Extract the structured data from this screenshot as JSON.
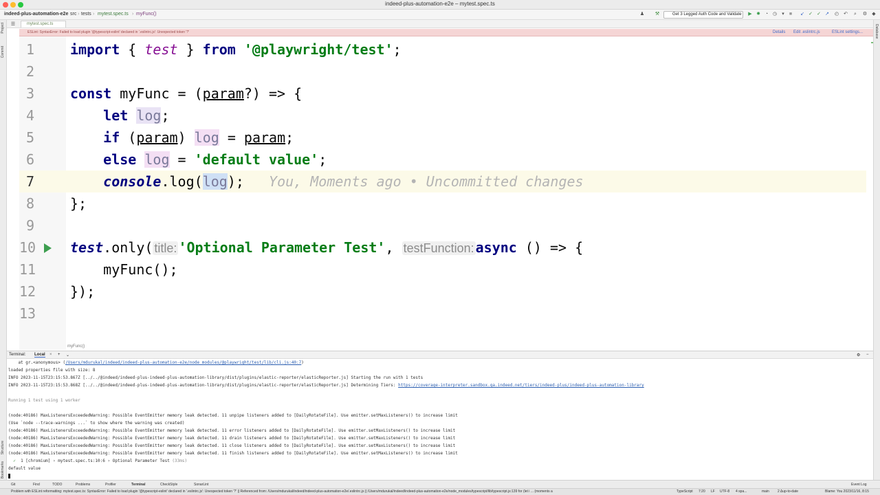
{
  "window": {
    "title": "indeed-plus-automation-e2e – mytest.spec.ts",
    "colors": {
      "close": "#ff5f57",
      "minimize": "#febc2e",
      "maximize": "#28c840"
    }
  },
  "navbar": {
    "project": "indeed-plus-automation-e2e",
    "crumbs": [
      "src",
      "tests",
      "mytest.spec.ts",
      "myFunc()"
    ],
    "run_config": "Get 3 Legged Auth Code and Validate"
  },
  "left_strip": {
    "project": "Project",
    "commit": "Commit",
    "structure": "Structure",
    "bookmarks": "Bookmarks"
  },
  "right_strip": {
    "database": "Database"
  },
  "editor_tab": {
    "label": "mytest.spec.ts"
  },
  "eslint_banner": {
    "message": "ESLint: SyntaxError: Failed to load plugin '@typescript-eslint' declared in '.eslintrc.js': Unexpected token '?'",
    "details": "Details",
    "edit": "Edit .eslintrc.js",
    "settings": "ESLint settings..."
  },
  "code": {
    "lines": [
      "1",
      "2",
      "3",
      "4",
      "5",
      "6",
      "7",
      "8",
      "9",
      "10",
      "11",
      "12",
      "13"
    ],
    "l1": {
      "kw": "import",
      "brace_open": " { ",
      "name": "test",
      "brace_close": " } ",
      "from": "from",
      "space": " ",
      "module": "'@playwright/test'",
      "semi": ";"
    },
    "l3": {
      "kw": "const",
      "rest1": " myFunc = (",
      "param": "param",
      "rest2": "?) => {"
    },
    "l4": {
      "indent": "    ",
      "kw": "let",
      "space": " ",
      "var": "log",
      "semi": ";"
    },
    "l5": {
      "indent": "    ",
      "kw": "if",
      "p1": " (",
      "param": "param",
      "p2": ") ",
      "var": "log",
      "eq": " = ",
      "param2": "param",
      "semi": ";"
    },
    "l6": {
      "indent": "    ",
      "kw": "else",
      "space": " ",
      "var": "log",
      "eq": " = ",
      "str": "'default value'",
      "semi": ";"
    },
    "l7": {
      "indent": "    ",
      "obj": "console",
      "method": ".log(",
      "var": "log",
      "close": ");",
      "gap": "   ",
      "blame": "You, Moments ago • Uncommitted changes"
    },
    "l8": {
      "text": "};"
    },
    "l10": {
      "fn": "test",
      "only": ".only(",
      "hint1": "title:",
      "str": "'Optional Parameter Test'",
      "comma": ", ",
      "hint2": "testFunction:",
      "kw": "async",
      "rest": " () => {"
    },
    "l11": {
      "indent": "    ",
      "call": "myFunc();"
    },
    "l12": {
      "text": "});"
    }
  },
  "editor_breadcrumb": "myFunc()",
  "terminal": {
    "tab_label": "Terminal:",
    "tab_name": "Local",
    "lines": {
      "t1_pre": "    at gr.<anonymous> (",
      "t1_link": "/Users/mdurukal/indeed/indeed-plus-automation-e2e/node_modules/@playwright/test/lib/cli.js:40:7",
      "t1_post": ")",
      "t2": "loaded properties file with size: 8",
      "t3": "INFO 2023-11-15T23:15:53.867Z [../../@indeed/indeed-plus-indeed-plus-automation-library/dist/plugins/elastic-reporter/elasticReporter.js] Starting the run with 1 tests",
      "t4_pre": "INFO 2023-11-15T23:15:53.868Z [../../@indeed/indeed-plus-indeed-plus-automation-library/dist/plugins/elastic-reporter/elasticReporter.js] Determining Tiers: ",
      "t4_link": "https://coverage-interpreter.sandbox.qa.indeed.net/tiers/indeed-plus/indeed-plus-automation-library",
      "t5": "Running 1 test using 1 worker",
      "t6": "(node:40186) MaxListenersExceededWarning: Possible EventEmitter memory leak detected. 11 unpipe listeners added to [DailyRotateFile]. Use emitter.setMaxListeners() to increase limit",
      "t7": "(Use `node --trace-warnings ...` to show where the warning was created)",
      "t8": "(node:40186) MaxListenersExceededWarning: Possible EventEmitter memory leak detected. 11 error listeners added to [DailyRotateFile]. Use emitter.setMaxListeners() to increase limit",
      "t9": "(node:40186) MaxListenersExceededWarning: Possible EventEmitter memory leak detected. 11 drain listeners added to [DailyRotateFile]. Use emitter.setMaxListeners() to increase limit",
      "t10": "(node:40186) MaxListenersExceededWarning: Possible EventEmitter memory leak detected. 11 close listeners added to [DailyRotateFile]. Use emitter.setMaxListeners() to increase limit",
      "t11": "(node:40186) MaxListenersExceededWarning: Possible EventEmitter memory leak detected. 11 finish listeners added to [DailyRotateFile]. Use emitter.setMaxListeners() to increase limit",
      "t12_check": "  ✓  ",
      "t12_rest": "1 [chromium] › mytest.spec.ts:10:6 › Optional Parameter Test ",
      "t12_time": "(33ms)",
      "t13": "default value"
    }
  },
  "bottom_tools": [
    "Git",
    "Find",
    "TODO",
    "Problems",
    "Profiler",
    "Terminal",
    "CheckStyle",
    "SonarLint"
  ],
  "event_log": "Event Log",
  "status": {
    "message": "Problem with ESLint reformatting: mytest.spec.ts: SyntaxError: Failed to load plugin '@typescript-eslint' declared in '.eslintrc.js': Unexpected token '?' || Referenced from: /Users/mdurukal/indeed/indeed-plus-automation-e2e/.eslintrc.js || /Users/mdurukal/indeed/indeed-plus-automation-e2e/node_modules/typescript/lib/typescript.js:139   for (let i ... (moments a",
    "lang": "TypeScript",
    "pos": "7:20",
    "eol": "LF",
    "enc": "UTF-8",
    "indent": "4 spa...",
    "branch": "main",
    "uptodate": "2 Δup-to-date",
    "blame": "Blame: You 2023/11/16, 8:15"
  }
}
